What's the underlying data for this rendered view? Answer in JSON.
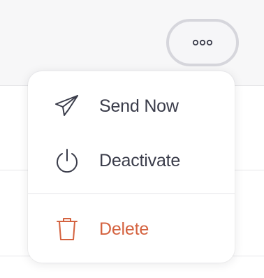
{
  "menu": {
    "items": [
      {
        "label": "Send Now",
        "icon": "paper-plane-icon"
      },
      {
        "label": "Deactivate",
        "icon": "power-icon"
      },
      {
        "label": "Delete",
        "icon": "trash-icon"
      }
    ]
  },
  "more_button": {
    "icon": "ellipsis-icon"
  },
  "colors": {
    "text": "#3a3c4a",
    "danger": "#d4623f",
    "button_border": "#d6d6dc",
    "band": "#f7f7f8"
  }
}
